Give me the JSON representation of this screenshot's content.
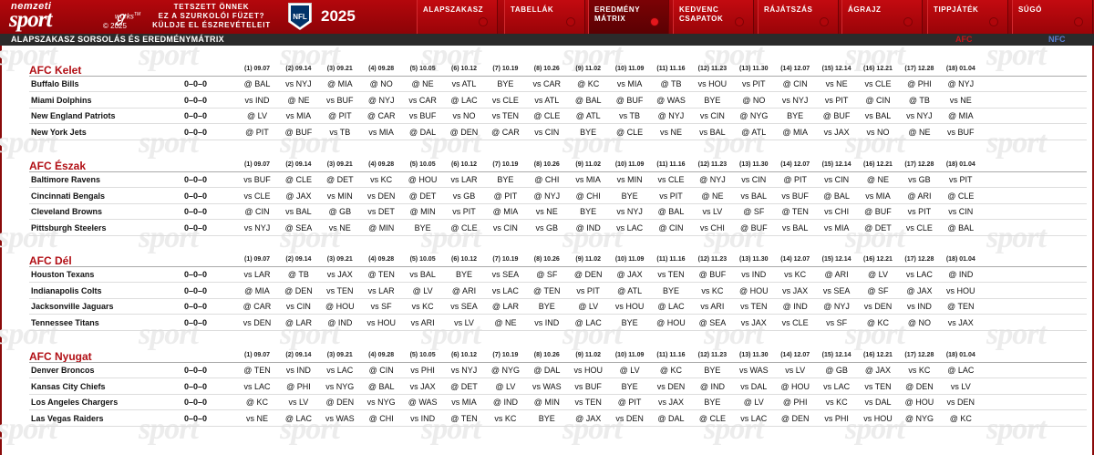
{
  "header": {
    "logo_line1": "nemzeti",
    "logo_line2": "sport",
    "works_brand": "works",
    "works_tm": "TM",
    "works_copy": "© 2025",
    "tagline": [
      "TETSZETT ÖNNEK",
      "EZ A SZURKOLÓI FÜZET?",
      "KÜLDJE EL ÉSZREVÉTELEIT"
    ],
    "nfl_text": "NFL",
    "year": "2025",
    "nav": [
      {
        "label": "ALAPSZAKASZ",
        "active": false
      },
      {
        "label": "TABELLÁK",
        "active": false
      },
      {
        "label": "EREDMÉNY MÁTRIX",
        "active": true
      },
      {
        "label": "KEDVENC CSAPATOK",
        "active": false
      },
      {
        "label": "RÁJÁTSZÁS",
        "active": false
      },
      {
        "label": "ÁGRAJZ",
        "active": false
      },
      {
        "label": "TIPPJÁTÉK",
        "active": false
      },
      {
        "label": "SÚGÓ",
        "active": false
      }
    ]
  },
  "subbar": {
    "title": "ALAPSZAKASZ SORSOLÁS ÉS EREDMÉNYMÁTRIX",
    "afc": "AFC",
    "nfc": "NFC"
  },
  "weeks": [
    "(1) 09.07",
    "(2) 09.14",
    "(3) 09.21",
    "(4) 09.28",
    "(5) 10.05",
    "(6) 10.12",
    "(7) 10.19",
    "(8) 10.26",
    "(9) 11.02",
    "(10) 11.09",
    "(11) 11.16",
    "(12) 11.23",
    "(13) 11.30",
    "(14) 12.07",
    "(15) 12.14",
    "(16) 12.21",
    "(17) 12.28",
    "(18) 01.04"
  ],
  "divisions": [
    {
      "name": "AFC Kelet",
      "teams": [
        {
          "name": "Buffalo Bills",
          "record": "0–0–0",
          "games": [
            "@ BAL",
            "vs NYJ",
            "@ MIA",
            "@ NO",
            "@ NE",
            "vs ATL",
            "BYE",
            "vs CAR",
            "@ KC",
            "vs MIA",
            "@ TB",
            "vs HOU",
            "vs PIT",
            "@ CIN",
            "vs NE",
            "vs CLE",
            "@ PHI",
            "@ NYJ"
          ]
        },
        {
          "name": "Miami Dolphins",
          "record": "0–0–0",
          "games": [
            "vs IND",
            "@ NE",
            "vs BUF",
            "@ NYJ",
            "vs CAR",
            "@ LAC",
            "vs CLE",
            "vs ATL",
            "@ BAL",
            "@ BUF",
            "@ WAS",
            "BYE",
            "@ NO",
            "vs NYJ",
            "vs PIT",
            "@ CIN",
            "@ TB",
            "vs NE"
          ]
        },
        {
          "name": "New England Patriots",
          "record": "0–0–0",
          "games": [
            "@ LV",
            "vs MIA",
            "@ PIT",
            "@ CAR",
            "vs BUF",
            "vs NO",
            "vs TEN",
            "@ CLE",
            "@ ATL",
            "vs TB",
            "@ NYJ",
            "vs CIN",
            "@ NYG",
            "BYE",
            "@ BUF",
            "vs BAL",
            "vs NYJ",
            "@ MIA"
          ]
        },
        {
          "name": "New York Jets",
          "record": "0–0–0",
          "games": [
            "@ PIT",
            "@ BUF",
            "vs TB",
            "vs MIA",
            "@ DAL",
            "@ DEN",
            "@ CAR",
            "vs CIN",
            "BYE",
            "@ CLE",
            "vs NE",
            "vs BAL",
            "@ ATL",
            "@ MIA",
            "vs JAX",
            "vs NO",
            "@ NE",
            "vs BUF"
          ]
        }
      ]
    },
    {
      "name": "AFC Észak",
      "teams": [
        {
          "name": "Baltimore Ravens",
          "record": "0–0–0",
          "games": [
            "vs BUF",
            "@ CLE",
            "@ DET",
            "vs KC",
            "@ HOU",
            "vs LAR",
            "BYE",
            "@ CHI",
            "vs MIA",
            "vs MIN",
            "vs CLE",
            "@ NYJ",
            "vs CIN",
            "@ PIT",
            "vs CIN",
            "@ NE",
            "vs GB",
            "vs PIT"
          ]
        },
        {
          "name": "Cincinnati Bengals",
          "record": "0–0–0",
          "games": [
            "vs CLE",
            "@ JAX",
            "vs MIN",
            "vs DEN",
            "@ DET",
            "vs GB",
            "@ PIT",
            "@ NYJ",
            "@ CHI",
            "BYE",
            "vs PIT",
            "@ NE",
            "vs BAL",
            "vs BUF",
            "@ BAL",
            "vs MIA",
            "@ ARI",
            "@ CLE"
          ]
        },
        {
          "name": "Cleveland Browns",
          "record": "0–0–0",
          "games": [
            "@ CIN",
            "vs BAL",
            "@ GB",
            "vs DET",
            "@ MIN",
            "vs PIT",
            "@ MIA",
            "vs NE",
            "BYE",
            "vs NYJ",
            "@ BAL",
            "vs LV",
            "@ SF",
            "@ TEN",
            "vs CHI",
            "@ BUF",
            "vs PIT",
            "vs CIN"
          ]
        },
        {
          "name": "Pittsburgh Steelers",
          "record": "0–0–0",
          "games": [
            "vs NYJ",
            "@ SEA",
            "vs NE",
            "@ MIN",
            "BYE",
            "@ CLE",
            "vs CIN",
            "vs GB",
            "@ IND",
            "vs LAC",
            "@ CIN",
            "vs CHI",
            "@ BUF",
            "vs BAL",
            "vs MIA",
            "@ DET",
            "vs CLE",
            "@ BAL"
          ]
        }
      ]
    },
    {
      "name": "AFC Dél",
      "teams": [
        {
          "name": "Houston Texans",
          "record": "0–0–0",
          "games": [
            "vs LAR",
            "@ TB",
            "vs JAX",
            "@ TEN",
            "vs BAL",
            "BYE",
            "vs SEA",
            "@ SF",
            "@ DEN",
            "@ JAX",
            "vs TEN",
            "@ BUF",
            "vs IND",
            "vs KC",
            "@ ARI",
            "@ LV",
            "vs LAC",
            "@ IND"
          ]
        },
        {
          "name": "Indianapolis Colts",
          "record": "0–0–0",
          "games": [
            "@ MIA",
            "@ DEN",
            "vs TEN",
            "vs LAR",
            "@ LV",
            "@ ARI",
            "vs LAC",
            "@ TEN",
            "vs PIT",
            "@ ATL",
            "BYE",
            "vs KC",
            "@ HOU",
            "vs JAX",
            "vs SEA",
            "@ SF",
            "@ JAX",
            "vs HOU"
          ]
        },
        {
          "name": "Jacksonville Jaguars",
          "record": "0–0–0",
          "games": [
            "@ CAR",
            "vs CIN",
            "@ HOU",
            "vs SF",
            "vs KC",
            "vs SEA",
            "@ LAR",
            "BYE",
            "@ LV",
            "vs HOU",
            "@ LAC",
            "vs ARI",
            "vs TEN",
            "@ IND",
            "@ NYJ",
            "vs DEN",
            "vs IND",
            "@ TEN"
          ]
        },
        {
          "name": "Tennessee Titans",
          "record": "0–0–0",
          "games": [
            "vs DEN",
            "@ LAR",
            "@ IND",
            "vs HOU",
            "vs ARI",
            "vs LV",
            "@ NE",
            "vs IND",
            "@ LAC",
            "BYE",
            "@ HOU",
            "@ SEA",
            "vs JAX",
            "vs CLE",
            "vs SF",
            "@ KC",
            "@ NO",
            "vs JAX"
          ]
        }
      ]
    },
    {
      "name": "AFC Nyugat",
      "teams": [
        {
          "name": "Denver Broncos",
          "record": "0–0–0",
          "games": [
            "@ TEN",
            "vs IND",
            "vs LAC",
            "@ CIN",
            "vs PHI",
            "vs NYJ",
            "@ NYG",
            "@ DAL",
            "vs HOU",
            "@ LV",
            "@ KC",
            "BYE",
            "vs WAS",
            "vs LV",
            "@ GB",
            "@ JAX",
            "vs KC",
            "@ LAC"
          ]
        },
        {
          "name": "Kansas City Chiefs",
          "record": "0–0–0",
          "games": [
            "vs LAC",
            "@ PHI",
            "vs NYG",
            "@ BAL",
            "vs JAX",
            "@ DET",
            "@ LV",
            "vs WAS",
            "vs BUF",
            "BYE",
            "vs DEN",
            "@ IND",
            "vs DAL",
            "@ HOU",
            "vs LAC",
            "vs TEN",
            "@ DEN",
            "vs LV"
          ]
        },
        {
          "name": "Los Angeles Chargers",
          "record": "0–0–0",
          "games": [
            "@ KC",
            "vs LV",
            "@ DEN",
            "vs NYG",
            "@ WAS",
            "vs MIA",
            "@ IND",
            "@ MIN",
            "vs TEN",
            "@ PIT",
            "vs JAX",
            "BYE",
            "@ LV",
            "@ PHI",
            "vs KC",
            "vs DAL",
            "@ HOU",
            "vs DEN"
          ]
        },
        {
          "name": "Las Vegas Raiders",
          "record": "0–0–0",
          "games": [
            "vs NE",
            "@ LAC",
            "vs WAS",
            "@ CHI",
            "vs IND",
            "@ TEN",
            "vs KC",
            "BYE",
            "@ JAX",
            "vs DEN",
            "@ DAL",
            "@ CLE",
            "vs LAC",
            "@ DEN",
            "vs PHI",
            "vs HOU",
            "@ NYG",
            "@ KC"
          ]
        }
      ]
    }
  ]
}
